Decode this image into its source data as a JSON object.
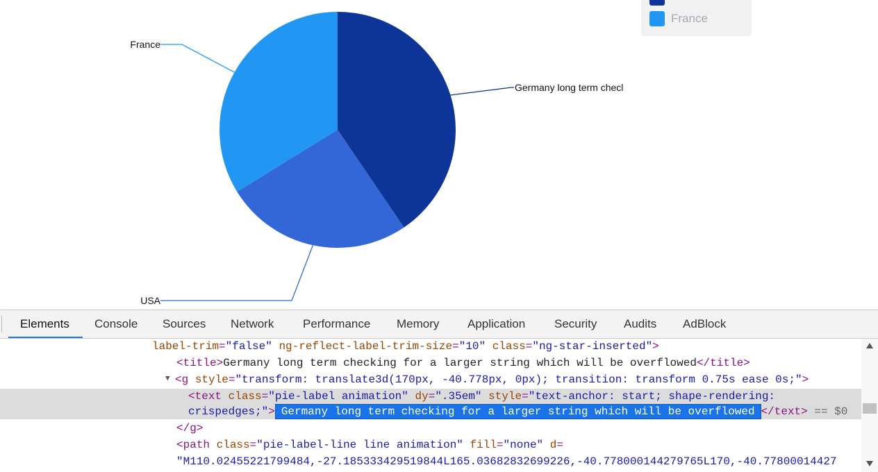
{
  "chart_data": {
    "type": "pie",
    "slices": [
      {
        "label": "Germany long term checl",
        "fraction": 0.405,
        "color": "#0d3597"
      },
      {
        "label": "USA",
        "fraction": 0.257,
        "color": "#3366d6"
      },
      {
        "label": "France",
        "fraction": 0.338,
        "color": "#2196f3"
      }
    ],
    "legend": {
      "placement": "top-right",
      "visible_items": [
        "France"
      ]
    }
  },
  "legend": {
    "france_label": "France",
    "colors": {
      "germany": "#0d3597",
      "france": "#2196f3"
    }
  },
  "devtools": {
    "tabs": [
      "Elements",
      "Console",
      "Sources",
      "Network",
      "Performance",
      "Memory",
      "Application",
      "Security",
      "Audits",
      "AdBlock"
    ],
    "active_tab": "Elements",
    "code": {
      "l1_attr1": "label-trim",
      "l1_val1": "\"false\"",
      "l1_attr2": "ng-reflect-label-trim-size",
      "l1_val2": "\"10\"",
      "l1_attr3": "class",
      "l1_val3": "\"ng-star-inserted\"",
      "l2_tag": "title",
      "l2_text": "Germany long term checking for a larger string which will be overflowed",
      "l3_tag": "g",
      "l3_attr": "style",
      "l3_val": "\"transform: translate3d(170px, -40.778px, 0px); transition: transform 0.75s ease 0s;\"",
      "l4_tag": "text",
      "l4_attr1": "class",
      "l4_val1": "\"pie-label animation\"",
      "l4_attr2": "dy",
      "l4_val2": "\".35em\"",
      "l4_attr3": "style",
      "l4_val3": "\"text-anchor: start; shape-rendering:",
      "l5_val": "crispedges;\"",
      "l5_selected_text": "Germany long term checking for a larger string which will be overflowed",
      "l5_suffix": " == $0",
      "l6_tag": "/g",
      "l7_tag": "path",
      "l7_attr1": "class",
      "l7_val1": "\"pie-label-line line animation\"",
      "l7_attr2": "fill",
      "l7_val2": "\"none\"",
      "l7_attr3": "d",
      "l8_val": "\"M110.02455221799484,-27.185333429519844L165.03682832699226,-40.778000144279765L170,-40.77800014427"
    }
  }
}
